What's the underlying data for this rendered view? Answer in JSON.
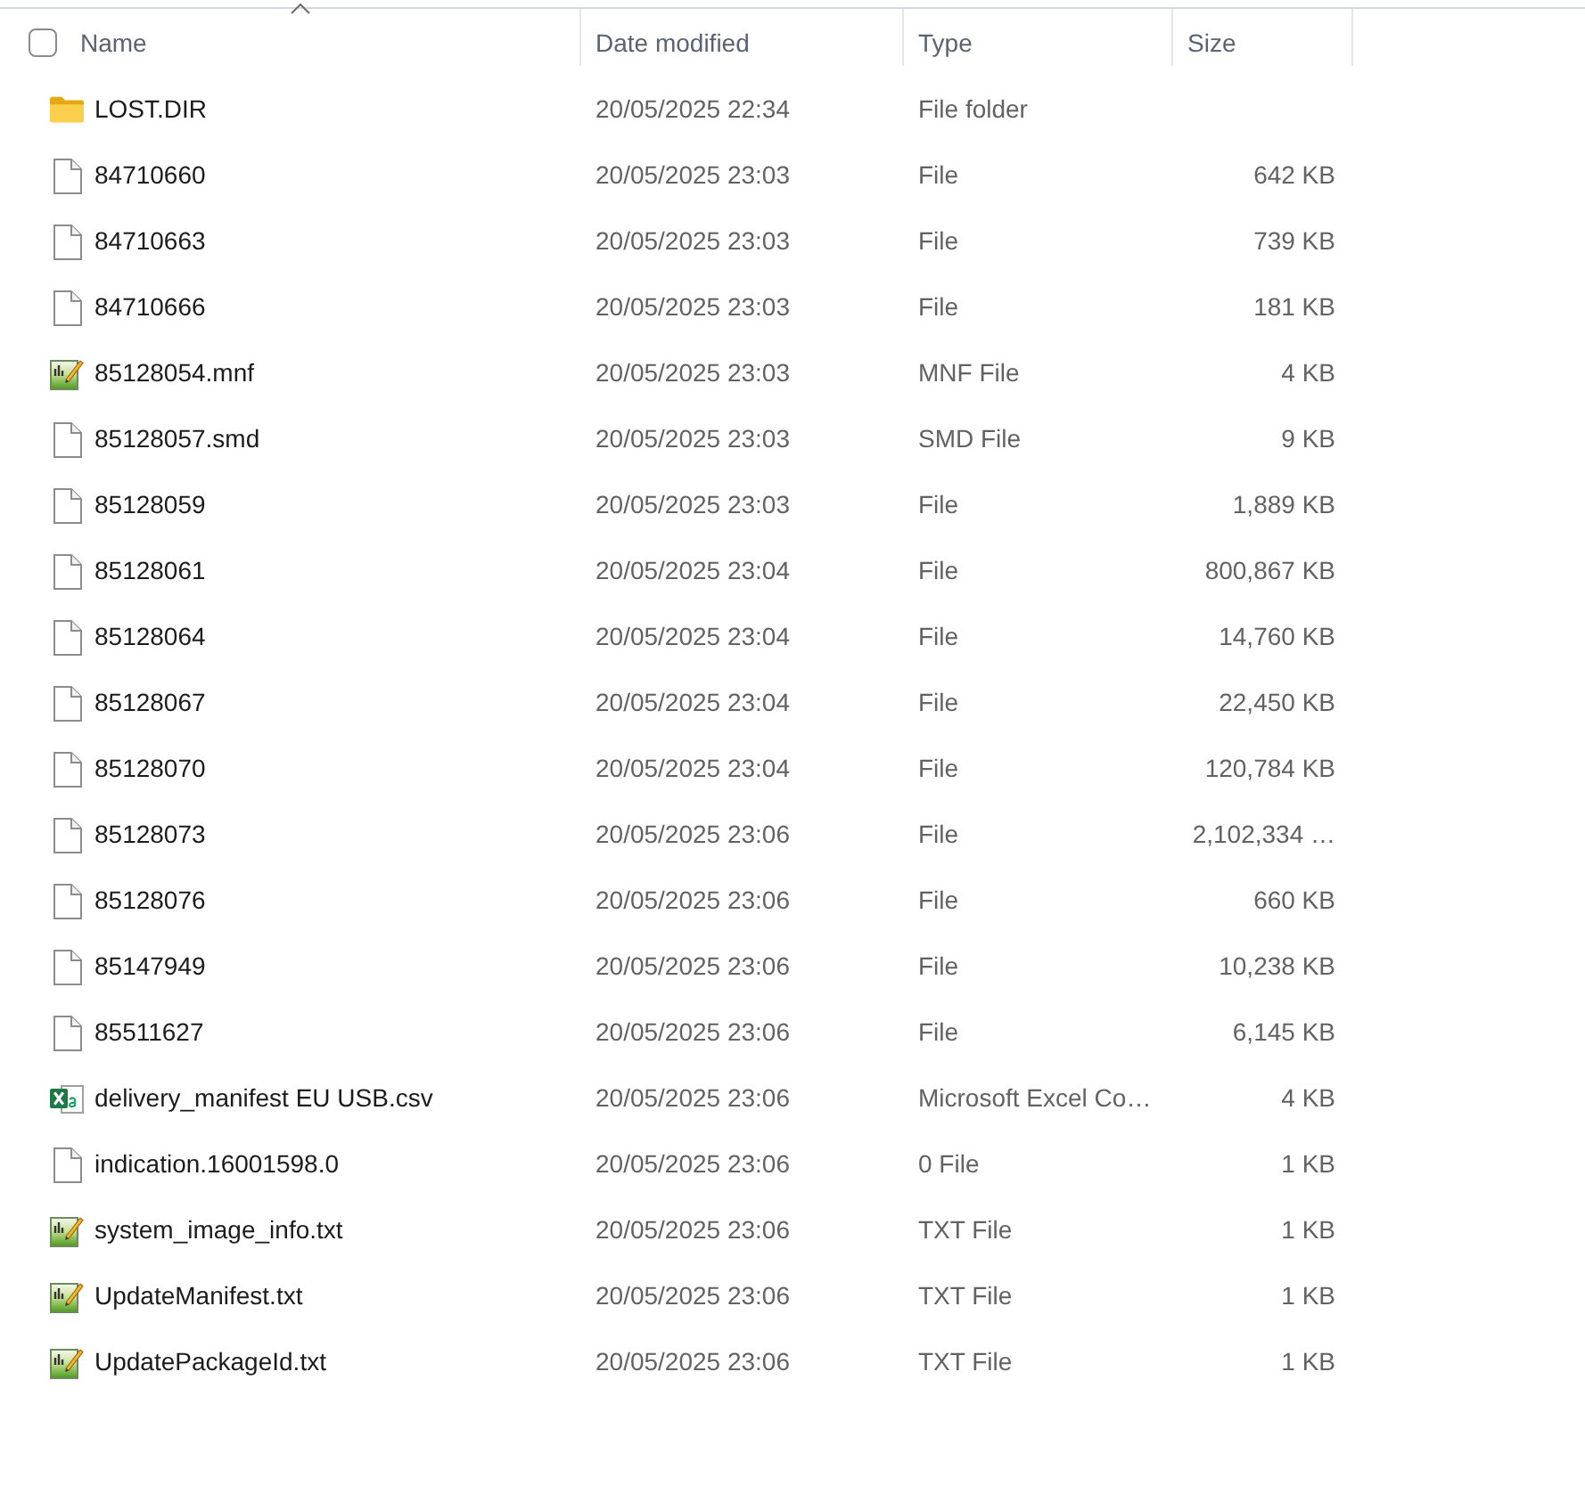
{
  "header": {
    "checkbox": {
      "checked": false
    },
    "columns": [
      {
        "label": "Name",
        "sorted": true
      },
      {
        "label": "Date modified",
        "sorted": false
      },
      {
        "label": "Type",
        "sorted": false
      },
      {
        "label": "Size",
        "sorted": false
      }
    ]
  },
  "files": [
    {
      "kind": "folder",
      "name": "LOST.DIR",
      "date_modified": "20/05/2025 22:34",
      "type": "File folder"
    },
    {
      "kind": "file",
      "name": "84710660",
      "date_modified": "20/05/2025 23:03",
      "type": "File",
      "size": "642 KB"
    },
    {
      "kind": "file",
      "name": "84710663",
      "date_modified": "20/05/2025 23:03",
      "type": "File",
      "size": "739 KB"
    },
    {
      "kind": "file",
      "name": "84710666",
      "date_modified": "20/05/2025 23:03",
      "type": "File",
      "size": "181 KB"
    },
    {
      "kind": "text",
      "name": "85128054.mnf",
      "date_modified": "20/05/2025 23:03",
      "type": "MNF File",
      "size": "4 KB"
    },
    {
      "kind": "file",
      "name": "85128057.smd",
      "date_modified": "20/05/2025 23:03",
      "type": "SMD File",
      "size": "9 KB"
    },
    {
      "kind": "file",
      "name": "85128059",
      "date_modified": "20/05/2025 23:03",
      "type": "File",
      "size": "1,889 KB"
    },
    {
      "kind": "file",
      "name": "85128061",
      "date_modified": "20/05/2025 23:04",
      "type": "File",
      "size": "800,867 KB"
    },
    {
      "kind": "file",
      "name": "85128064",
      "date_modified": "20/05/2025 23:04",
      "type": "File",
      "size": "14,760 KB"
    },
    {
      "kind": "file",
      "name": "85128067",
      "date_modified": "20/05/2025 23:04",
      "type": "File",
      "size": "22,450 KB"
    },
    {
      "kind": "file",
      "name": "85128070",
      "date_modified": "20/05/2025 23:04",
      "type": "File",
      "size": "120,784 KB"
    },
    {
      "kind": "file",
      "name": "85128073",
      "date_modified": "20/05/2025 23:06",
      "type": "File",
      "size": "2,102,334 …"
    },
    {
      "kind": "file",
      "name": "85128076",
      "date_modified": "20/05/2025 23:06",
      "type": "File",
      "size": "660 KB"
    },
    {
      "kind": "file",
      "name": "85147949",
      "date_modified": "20/05/2025 23:06",
      "type": "File",
      "size": "10,238 KB"
    },
    {
      "kind": "file",
      "name": "85511627",
      "date_modified": "20/05/2025 23:06",
      "type": "File",
      "size": "6,145 KB"
    },
    {
      "kind": "spreadsheet",
      "name": "delivery_manifest EU USB.csv",
      "date_modified": "20/05/2025 23:06",
      "type": "Microsoft Excel Co…",
      "size": "4 KB"
    },
    {
      "kind": "file",
      "name": "indication.16001598.0",
      "date_modified": "20/05/2025 23:06",
      "type": "0 File",
      "size": "1 KB"
    },
    {
      "kind": "text",
      "name": "system_image_info.txt",
      "date_modified": "20/05/2025 23:06",
      "type": "TXT File",
      "size": "1 KB"
    },
    {
      "kind": "text",
      "name": "UpdateManifest.txt",
      "date_modified": "20/05/2025 23:06",
      "type": "TXT File",
      "size": "1 KB"
    },
    {
      "kind": "text",
      "name": "UpdatePackageId.txt",
      "date_modified": "20/05/2025 23:06",
      "type": "TXT File",
      "size": "1 KB"
    }
  ]
}
